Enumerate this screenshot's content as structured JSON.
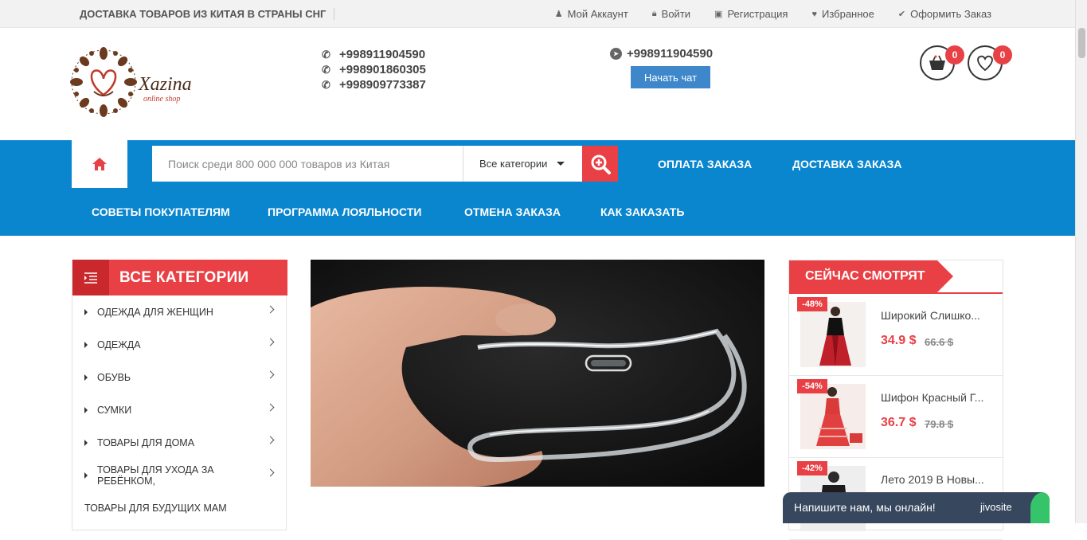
{
  "topbar": {
    "promo": "ДОСТАВКА ТОВАРОВ ИЗ КИТАЯ В СТРАНЫ СНГ",
    "links": [
      {
        "label": "Мой Аккаунт",
        "icon": "user-icon"
      },
      {
        "label": "Войти",
        "icon": "lock-icon"
      },
      {
        "label": "Регистрация",
        "icon": "id-card-icon"
      },
      {
        "label": "Избранное",
        "icon": "heart-icon"
      },
      {
        "label": "Оформить Заказ",
        "icon": "check-icon"
      }
    ]
  },
  "header": {
    "logo_name": "Xazina",
    "logo_tagline": "online shop",
    "phones": [
      "+998911904590",
      "+998901860305",
      "+998909773387"
    ],
    "telegram_phone": "+998911904590",
    "chat_button": "Начать чат",
    "cart_count": "0",
    "wishlist_count": "0"
  },
  "nav": {
    "search_placeholder": "Поиск среди 800 000 000 товаров из Китая",
    "category_select": "Все категории",
    "links_row1": [
      "ОПЛАТА ЗАКАЗА",
      "ДОСТАВКА ЗАКАЗА"
    ],
    "links_row2": [
      "СОВЕТЫ ПОКУПАТЕЛЯМ",
      "ПРОГРАММА ЛОЯЛЬНОСТИ",
      "ОТМЕНА ЗАКАЗА",
      "КАК ЗАКАЗАТЬ"
    ]
  },
  "sidebar": {
    "title": "ВСЕ КАТЕГОРИИ",
    "items": [
      "ОДЕЖДА ДЛЯ ЖЕНЩИН",
      "ОДЕЖДА",
      "ОБУВЬ",
      "СУМКИ",
      "ТОВАРЫ ДЛЯ ДОМА",
      "ТОВАРЫ ДЛЯ УХОДА ЗА РЕБЁНКОМ,"
    ],
    "item_continuation": "ТОВАРЫ ДЛЯ БУДУЩИХ МАМ"
  },
  "watching": {
    "title": "СЕЙЧАС СМОТРЯТ",
    "products": [
      {
        "discount": "-48%",
        "name": "Широкий Слишко...",
        "price": "34.9 $",
        "old_price": "66.6 $"
      },
      {
        "discount": "-54%",
        "name": "Шифон Красный Г...",
        "price": "36.7 $",
        "old_price": "79.8 $"
      },
      {
        "discount": "-42%",
        "name": "Лето 2019 В Новы...",
        "price": "",
        "old_price": ""
      }
    ]
  },
  "livechat": {
    "text": "Напишите нам, мы онлайн!",
    "brand": "jivosite"
  },
  "colors": {
    "accent_red": "#e84045",
    "nav_blue": "#0a86cf",
    "chat_blue": "#3f87cb"
  }
}
